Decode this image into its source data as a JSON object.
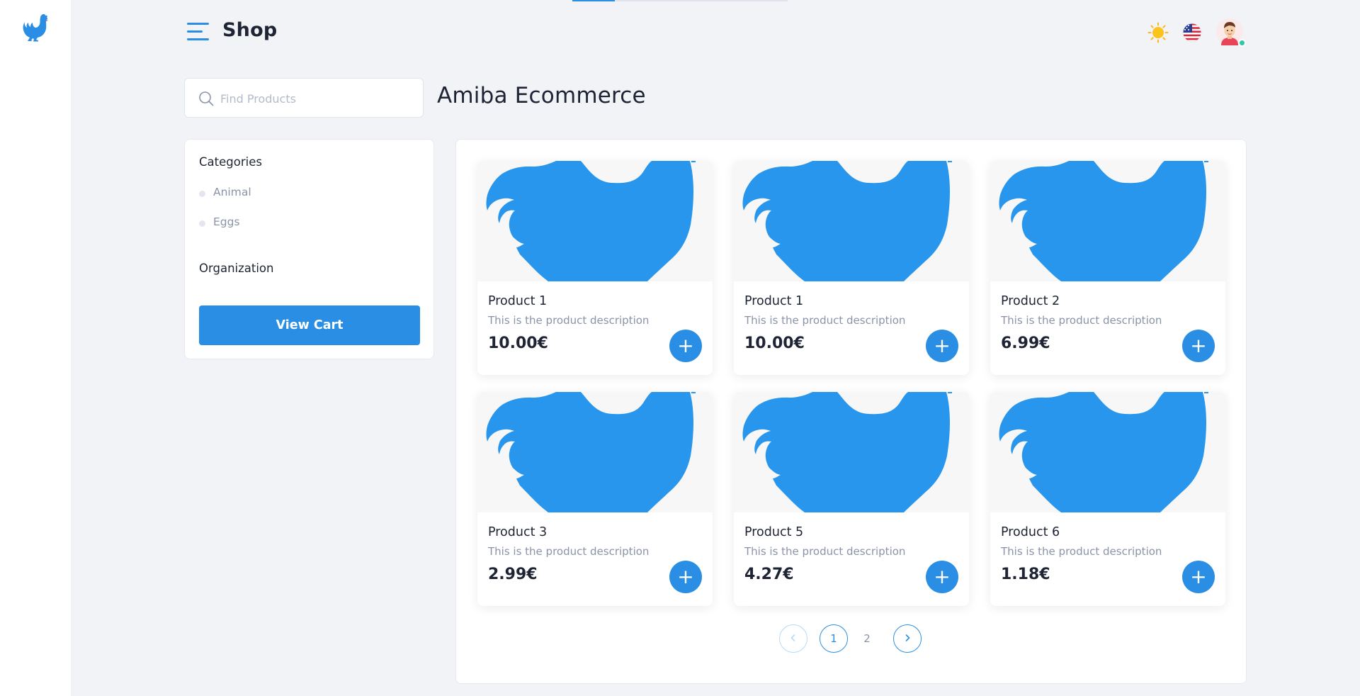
{
  "app": {
    "logo_icon": "rooster-icon",
    "accent_color": "#2a8fe4"
  },
  "header": {
    "title": "Shop",
    "menu_icon": "hamburger-menu-icon",
    "theme_icon": "sun-icon",
    "language_icon": "us-flag-icon",
    "avatar_icon": "user-avatar-icon",
    "avatar_status": "online"
  },
  "search": {
    "placeholder": "Find Products",
    "value": ""
  },
  "shop_heading": "Amiba Ecommerce",
  "sidebar": {
    "categories_title": "Categories",
    "categories": [
      {
        "label": "Animal"
      },
      {
        "label": "Eggs"
      }
    ],
    "organization_title": "Organization",
    "view_cart_label": "View Cart"
  },
  "products": [
    {
      "name": "Product 1",
      "description": "This is the product description",
      "price": "10.00€",
      "add_label": "+"
    },
    {
      "name": "Product 1",
      "description": "This is the product description",
      "price": "10.00€",
      "add_label": "+"
    },
    {
      "name": "Product 2",
      "description": "This is the product description",
      "price": "6.99€",
      "add_label": "+"
    },
    {
      "name": "Product 3",
      "description": "This is the product description",
      "price": "2.99€",
      "add_label": "+"
    },
    {
      "name": "Product 5",
      "description": "This is the product description",
      "price": "4.27€",
      "add_label": "+"
    },
    {
      "name": "Product 6",
      "description": "This is the product description",
      "price": "1.18€",
      "add_label": "+"
    }
  ],
  "pagination": {
    "prev_label": "‹",
    "pages": [
      "1",
      "2"
    ],
    "current_page": "1",
    "next_label": "›"
  }
}
